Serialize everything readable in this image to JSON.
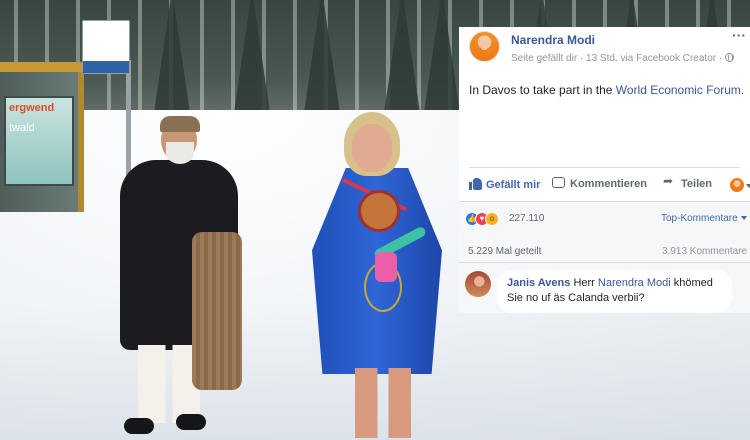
{
  "photo": {
    "shelter_ad_line1": "ergwend",
    "shelter_ad_line2": "twald"
  },
  "post": {
    "author": "Narendra Modi",
    "sub_line": "Seite gefällt dir · 13 Std. via Facebook Creator ·",
    "more_label": "···",
    "text_prefix": "In Davos to take part in the ",
    "text_link": "World Economic Forum",
    "text_suffix": ".",
    "actions": {
      "like": "Gefällt mir",
      "comment": "Kommentieren",
      "share": "Teilen"
    }
  },
  "meta": {
    "reactions": [
      "like",
      "love",
      "wow"
    ],
    "reaction_count": "227.110",
    "top_comments": "Top-Kommentare",
    "shares": "5.229 Mal geteilt",
    "comments_count": "3.913 Kommentare"
  },
  "comment": {
    "author": "Janis Avens",
    "before_mention": "Herr",
    "mention": "Narendra Modi",
    "after_mention": "khömed Sie no uf äs Calanda verbii?"
  },
  "colors": {
    "link_blue": "#385898",
    "fb_blue": "#4267b2",
    "text_dark": "#1d2129",
    "muted": "#90949c"
  }
}
